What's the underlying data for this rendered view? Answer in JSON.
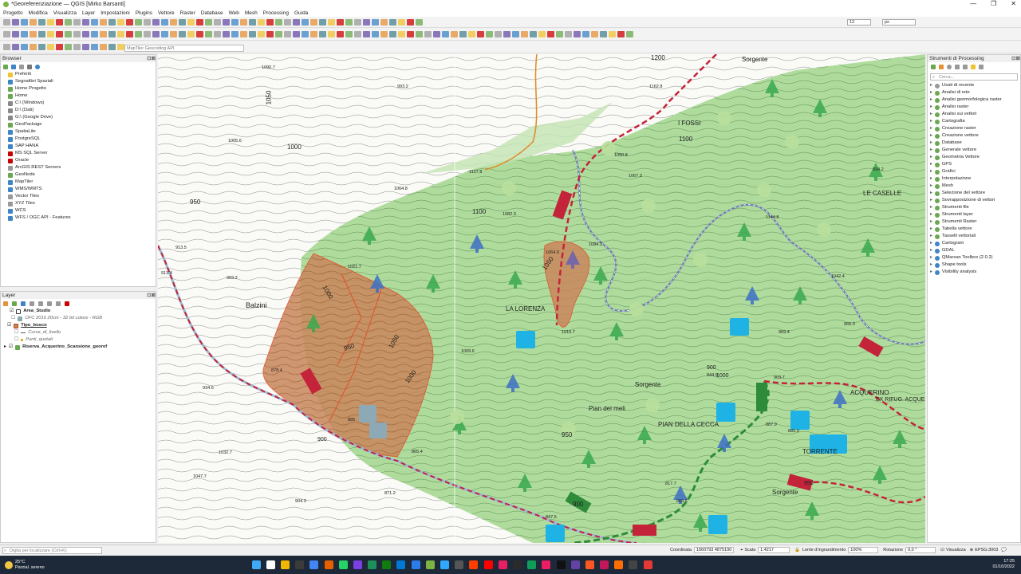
{
  "window": {
    "title": "*Georeferenziazione — QGIS [Mirko Barsanti]"
  },
  "menu": [
    "Progetto",
    "Modifica",
    "Visualizza",
    "Layer",
    "Impostazioni",
    "Plugins",
    "Vettore",
    "Raster",
    "Database",
    "Web",
    "Mesh",
    "Processing",
    "Guida"
  ],
  "toolbar": {
    "scale_value": "12",
    "unit_value": "px",
    "search_placeholder": "MapTiler Geocoding API"
  },
  "browser": {
    "title": "Browser",
    "items": [
      "Preferiti",
      "Segnalibri Spaziali",
      "Home Progetto",
      "Home",
      "C:\\ (Windows)",
      "D:\\ (Dati)",
      "G:\\ (Google Drive)",
      "GeoPackage",
      "SpatiaLite",
      "PostgreSQL",
      "SAP HANA",
      "MS SQL Server",
      "Oracle",
      "ArcGIS REST Servers",
      "GeoNode",
      "MapTiler",
      "WMS/WMTS",
      "Vector Tiles",
      "XYZ Tiles",
      "WCS",
      "WFS / OGC API - Features"
    ]
  },
  "layers": {
    "title": "Layer",
    "items": [
      {
        "name": "Area_Studio",
        "bold": true
      },
      {
        "name": "OFC 2016 20cm - 32 bit colore - RGB",
        "bold": false,
        "italic": true
      },
      {
        "name": "Tipo_bosco",
        "bold": true
      },
      {
        "name": "Curve_di_livello",
        "bold": false,
        "italic": true
      },
      {
        "name": "Punti_quotati",
        "bold": false,
        "italic": true
      },
      {
        "name": "Riserva_Acquerino_Scansione_georef",
        "bold": true
      }
    ]
  },
  "processing": {
    "title": "Strumenti di Processing",
    "search_placeholder": "Cerca...",
    "items": [
      "Usati di recente",
      "Analisi di rete",
      "Analisi geomorfologica raster",
      "Analisi raster",
      "Analisi sui vettori",
      "Cartografia",
      "Creazione raster",
      "Creazione vettore",
      "Database",
      "Generale vettore",
      "Geometria Vettore",
      "GPS",
      "Grafici",
      "Interpolazione",
      "Mesh",
      "Selezione del vettore",
      "Sovrapposizione di vettori",
      "Strumenti file",
      "Strumenti layer",
      "Strumenti Raster",
      "Tabella vettore",
      "Tasselli vettoriali",
      "Cartogram",
      "GDAL",
      "QMarxan Toolbox (2.0.2)",
      "Shape tools",
      "Visibility analysis"
    ]
  },
  "map": {
    "labels": [
      "1200",
      "Sorgente",
      "I FOSSI",
      "1100",
      "LE CASELLE",
      "Balzini",
      "LA LORENZA",
      "Sorgente",
      "Pian dei meli",
      "PIAN DELLA CECCA",
      "ACQUERINO",
      "TORRENTE",
      "Sorgente",
      "EX RIFUG. ACQUER",
      "950",
      "1000",
      "1050",
      "1100",
      "900",
      "1050",
      "1000",
      "900",
      "950",
      "1050",
      "1000",
      "1000",
      "900",
      "950",
      "950"
    ],
    "spots": [
      "1090.7",
      "993.2",
      "1005.6",
      "1162.8",
      "1127.8",
      "1064.8",
      "1082.3",
      "1067.3",
      "1090.8",
      "913.5",
      "913.4",
      "959.2",
      "1021.7",
      "1084.3",
      "1064.0",
      "1019.7",
      "1009.6",
      "1042.4",
      "1144.8",
      "934.2",
      "966.0",
      "878.4",
      "934.6",
      "885",
      "865.4",
      "1032.7",
      "1047.7",
      "904.3",
      "871.2",
      "847.5",
      "817.7",
      "863.5",
      "887.9",
      "903.7",
      "885.0",
      "844.9",
      "969.4"
    ]
  },
  "status": {
    "locator_placeholder": "Digita per localizzare (Ctrl+K)",
    "coord_label": "Coordinata",
    "coord_value": "1660793 4875190",
    "scale_label": "Scala",
    "scale_value": "1:4217",
    "magnifier_label": "Lente d'ingrandimento",
    "magnifier_value": "100%",
    "rotation_label": "Rotazione",
    "rotation_value": "0,0 °",
    "render_label": "Visualizza",
    "crs": "EPSG:3003"
  },
  "taskbar": {
    "weather_temp": "25°C",
    "weather_text": "Parzial. sereno",
    "time": "17:25",
    "date": "01/10/2022"
  },
  "colors": {
    "forest": "#9fd48a",
    "forest_dark": "#76c16a",
    "study_area": "#c9855a",
    "water": "#7d9bc8",
    "road": "#c4243a",
    "accent": "#1fb3e5"
  }
}
